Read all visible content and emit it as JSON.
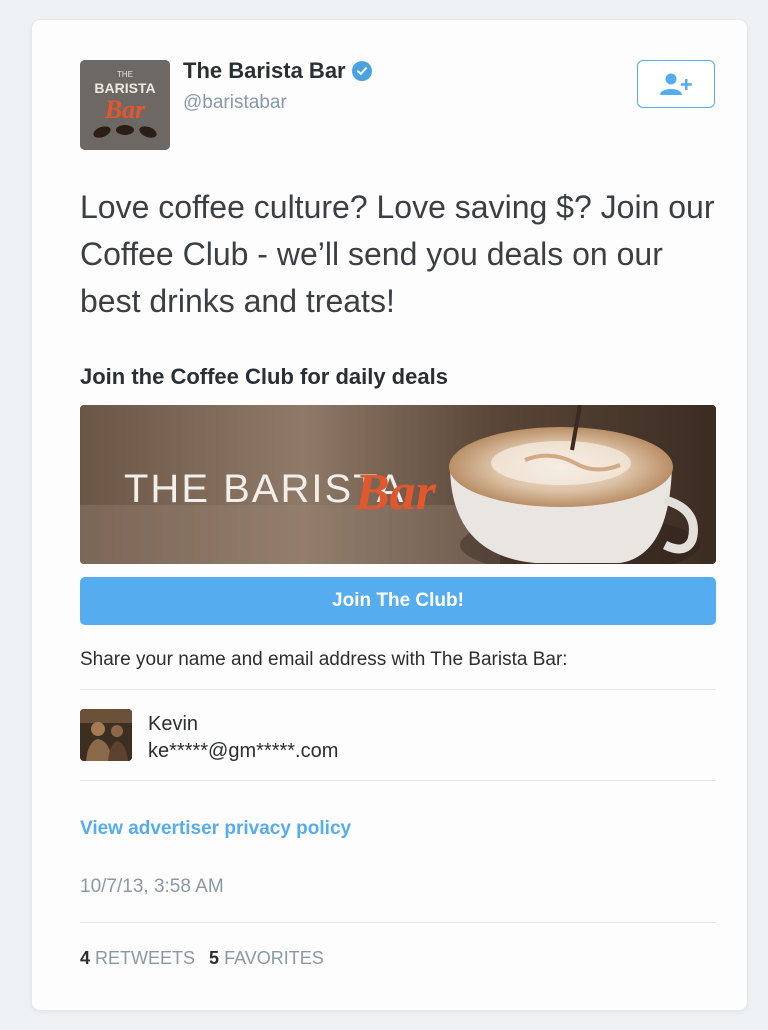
{
  "account": {
    "name": "The Barista Bar",
    "handle": "@baristabar",
    "avatar_text_top": "THE",
    "avatar_text_mid": "BARISTA",
    "avatar_text_script": "Bar"
  },
  "tweet": {
    "text": "Love coffee culture? Love saving $? Join our Coffee Club - we’ll send you deals on our best drinks and treats!"
  },
  "lead_card": {
    "title": "Join the Coffee Club for daily deals",
    "banner_text_main": "THE BARISTA",
    "banner_text_script": "Bar",
    "button_label": "Join The Club!",
    "share_text": "Share your name and email address with The Barista Bar:"
  },
  "user": {
    "name": "Kevin",
    "email": "ke*****@gm*****.com"
  },
  "privacy_link": "View advertiser privacy policy",
  "timestamp": "10/7/13, 3:58 AM",
  "stats": {
    "retweets_count": "4",
    "retweets_label": "RETWEETS",
    "favorites_count": "5",
    "favorites_label": "FAVORITES"
  },
  "colors": {
    "accent": "#55acee",
    "verified": "#4aa3df",
    "script_orange": "#e2572e"
  },
  "icons": [
    "verified-badge-icon",
    "follow-user-icon"
  ]
}
